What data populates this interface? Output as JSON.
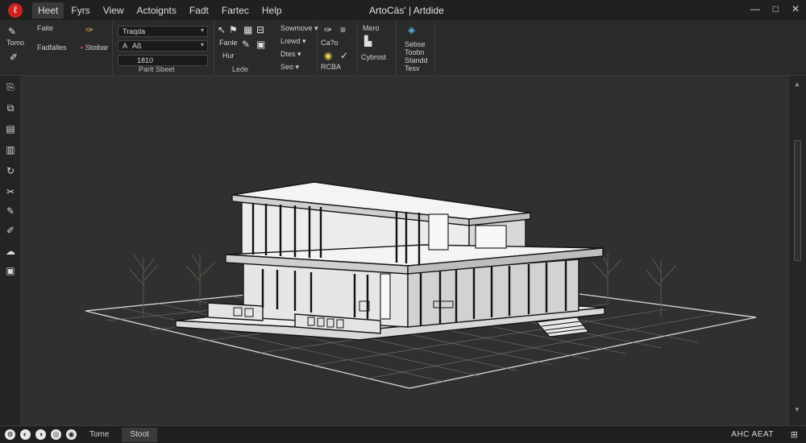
{
  "titlebar": {
    "menus": [
      "Heet",
      "Fyrs",
      "View",
      "Actoignts",
      "Fadt",
      "Fartec",
      "Help"
    ],
    "active_menu": 0,
    "title": "ArtoCäs' | Artdide",
    "controls": [
      "—",
      "□",
      "✕"
    ]
  },
  "ribbon": {
    "panel1": {
      "label1": "Tomo",
      "label2": "Faite",
      "label3": "Fadfalles",
      "label4": "Stoibar"
    },
    "panel2": {
      "title": "Parlt Sbeet",
      "dropdown1": "Traqda",
      "dropdown2_prefix": "A",
      "dropdown2": "Aß",
      "dropdown3": "1810"
    },
    "panel3": {
      "row1": "Sowmove",
      "row2": "Lrewd",
      "row3": "Dtes",
      "row4": "Seo",
      "label_a": "Fanle",
      "label_b": "Hur",
      "title": "Lede"
    },
    "panel4": {
      "label1": "Ca?o",
      "label2": "RCBA"
    },
    "panel5": {
      "label1": "Mero",
      "label2": "Cybrost"
    },
    "panel6": {
      "label1": "Sebse",
      "label2": "Toobn",
      "label3": "Standd",
      "label4": "Tesv"
    }
  },
  "status": {
    "tabs": [
      "Tome",
      "Stoot"
    ],
    "active_tab": 1,
    "right_text": "AHC AEAT",
    "right_icon": "⊞"
  }
}
